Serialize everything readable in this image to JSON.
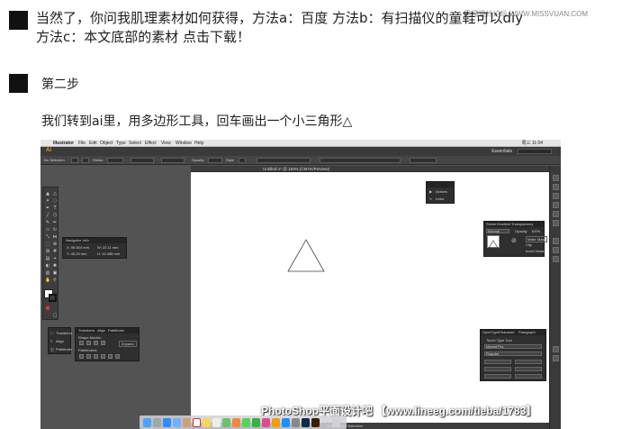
{
  "watermark_top": "思缘设计论坛 WWW.MISSVUAN.COM",
  "intro": {
    "line1": "当然了，你问我肌理素材如何获得，方法a：百度 方法b：有扫描仪的童鞋可以diy",
    "line2": "方法c：本文底部的素材 点击下载！"
  },
  "step": {
    "title": "第二步",
    "description": "我们转到ai里，用多边形工具，回车画出一个小三角形△"
  },
  "screenshot": {
    "mac_menu": {
      "apple": "",
      "items": [
        "Illustrator",
        "File",
        "Edit",
        "Object",
        "Type",
        "Select",
        "Effect",
        "View",
        "Window",
        "Help"
      ],
      "clock": "周三 11:04"
    },
    "app_bar": {
      "logo": "Ai",
      "workspace": "Essentials"
    },
    "control_bar": {
      "no_selection": "No Selection",
      "stroke_label": "Stroke",
      "opacity_label": "Opacity",
      "style_label": "Style"
    },
    "document_tab": "Untitled-1* @ 150% (CMYK/Preview)",
    "navigator_panel": {
      "tabs": [
        "Navigator",
        "Info"
      ],
      "x": "X: 96.504 mm",
      "y": "Y: 40.24 mm",
      "w": "W: 22.11 mm",
      "h": "H: 19.458 mm"
    },
    "actions_panel": {
      "items": [
        "Actions",
        "Links"
      ]
    },
    "transparency_panel": {
      "tabs": [
        "Stroke",
        "Gradient",
        "Transparency"
      ],
      "mode": "Normal",
      "opacity_label": "Opacity:",
      "opacity_value": "100%",
      "make_mask": "Make Mask",
      "clip": "Clip",
      "invert": "Invert Mask"
    },
    "pathfinder_panel": {
      "tabs": [
        "Transform",
        "Align",
        "Pathfinder"
      ],
      "shape_modes": "Shape Modes:",
      "pathfinders": "Pathfinders:",
      "expand": "Expand"
    },
    "side_list": {
      "items": [
        "Transform",
        "Align",
        "Pathfinder"
      ]
    },
    "character_panel": {
      "tabs": [
        "OpenType",
        "Character",
        "Paragraph"
      ],
      "search": "Touch Type Tool",
      "font": "Myriad Pro",
      "style": "Regular"
    },
    "status_bar": "Toggle Direct Selection"
  },
  "bottom_watermark": "PhotoShop平面设计吧 【www.lineeg.com/tieba/1783】",
  "colors": {
    "app_bg": "#535353",
    "panel": "#2f2f2f",
    "ai_orange": "#ff9a00"
  }
}
